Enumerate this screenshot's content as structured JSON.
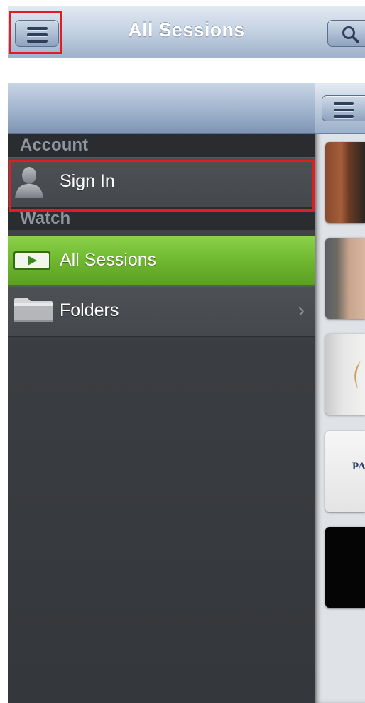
{
  "nav": {
    "title": "All Sessions",
    "menu_icon": "hamburger-menu-icon",
    "search_icon": "search-icon"
  },
  "sidebar": {
    "sections": [
      {
        "header": "Account",
        "items": [
          {
            "label": "Sign In",
            "icon": "user-silhouette-icon"
          }
        ]
      },
      {
        "header": "Watch",
        "items": [
          {
            "label": "All Sessions",
            "icon": "video-play-icon",
            "active": true
          },
          {
            "label": "Folders",
            "icon": "folder-icon",
            "chevron": "›"
          }
        ]
      }
    ]
  },
  "thumbnails": {
    "thumb4_text": "PA"
  },
  "colors": {
    "highlight": "#e01d23",
    "active_item": "#6db52e",
    "sidebar_bg": "#3b3e43",
    "nav_bar": "#c6d3e3"
  }
}
